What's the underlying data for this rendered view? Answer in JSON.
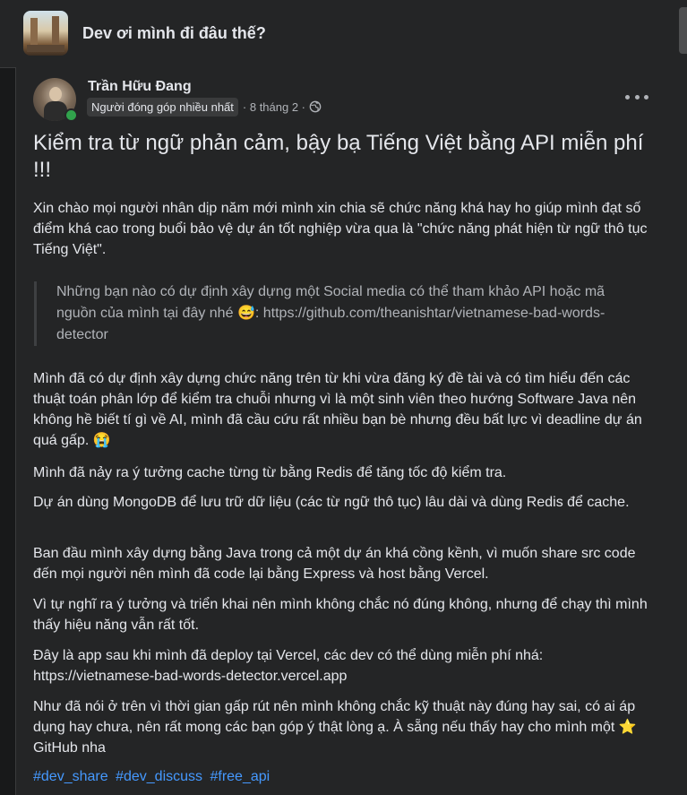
{
  "group": {
    "name": "Dev ơi mình đi đâu thế?",
    "avatar_icon": "group-photo-icon"
  },
  "post": {
    "author": "Trần Hữu Đang",
    "badge": "Người đóng góp nhiều nhất",
    "time": "· 8 tháng 2 ·",
    "title": "Kiểm tra từ ngữ phản cảm, bậy bạ Tiếng Việt bằng API miễn phí !!!",
    "intro": "Xin chào mọi người nhân dịp năm mới mình xin chia sẽ chức năng khá hay ho giúp mình đạt số điểm khá cao trong buổi bảo vệ dự án tốt nghiệp vừa qua là \"chức năng phát hiện từ ngữ thô tục Tiếng Việt\".",
    "quote_text": "Những bạn nào có dự định xây dựng một Social media có thể tham khảo API hoặc mã nguồn của mình tại đây nhé",
    "quote_emoji": "😅",
    "quote_link": ": https://github.com/theanishtar/vietnamese-bad-words-detector",
    "p1": "Mình đã có dự định xây dựng chức năng trên từ khi vừa đăng ký đề tài và có tìm hiểu đến các thuật toán phân lớp để kiểm tra chuỗi nhưng vì là một sinh viên theo hướng Software Java nên không hề biết tí gì về AI, mình đã cầu cứu rất nhiều bạn bè nhưng đều bất lực vì deadline dự án quá gấp.",
    "p1_emoji": "😭",
    "p2": "Mình đã nảy ra ý tưởng cache từng từ bằng Redis để tăng tốc độ kiểm tra.",
    "p3": "Dự án dùng MongoDB để lưu trữ dữ liệu (các từ ngữ thô tục) lâu dài và dùng Redis để cache.",
    "p4": "Ban đầu mình xây dựng bằng Java trong cả một dự án khá cồng kềnh, vì muốn share src code đến mọi người nên mình đã code lại bằng Express và host bằng Vercel.",
    "p5": "Vì tự nghĩ ra ý tưởng và triển khai nên mình không chắc nó đúng không, nhưng để chạy thì mình thấy hiệu năng vẫn rất tốt.",
    "p6": "Đây là app sau khi mình đã deploy tại Vercel, các dev có thể dùng miễn phí nhá: https://vietnamese-bad-words-detector.vercel.app",
    "p7_a": "Như đã nói ở trên vì thời gian gấp rút nên mình không chắc kỹ thuật này đúng hay sai, có ai áp dụng hay chưa, nên rất mong các bạn góp ý thật lòng ạ. À sẵng nếu thấy hay cho mình một",
    "p7_emoji": "⭐",
    "p7_b": " GitHub nha",
    "hashtags": [
      "#dev_share",
      "#dev_discuss",
      "#free_api"
    ]
  },
  "colors": {
    "background": "#18191a",
    "card": "#242526",
    "text": "#e4e6eb",
    "muted": "#b0b3b8",
    "link": "#4599ff",
    "online": "#31a24c"
  }
}
